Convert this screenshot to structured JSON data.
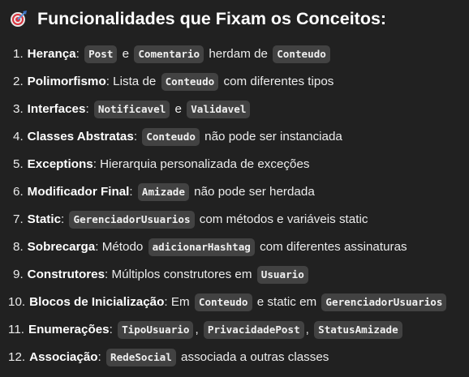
{
  "heading": {
    "icon": "target-icon",
    "title": "Funcionalidades que Fixam os Conceitos:"
  },
  "items": [
    {
      "num": "1.",
      "parts": [
        {
          "t": "b",
          "v": "Herança"
        },
        {
          "t": "p",
          "v": ": "
        },
        {
          "t": "c",
          "v": "Post"
        },
        {
          "t": "p",
          "v": " e "
        },
        {
          "t": "c",
          "v": "Comentario"
        },
        {
          "t": "p",
          "v": " herdam de "
        },
        {
          "t": "c",
          "v": "Conteudo"
        }
      ]
    },
    {
      "num": "2.",
      "parts": [
        {
          "t": "b",
          "v": "Polimorfismo"
        },
        {
          "t": "p",
          "v": ": Lista de "
        },
        {
          "t": "c",
          "v": "Conteudo"
        },
        {
          "t": "p",
          "v": " com diferentes tipos"
        }
      ]
    },
    {
      "num": "3.",
      "parts": [
        {
          "t": "b",
          "v": "Interfaces"
        },
        {
          "t": "p",
          "v": ": "
        },
        {
          "t": "c",
          "v": "Notificavel"
        },
        {
          "t": "p",
          "v": " e "
        },
        {
          "t": "c",
          "v": "Validavel"
        }
      ]
    },
    {
      "num": "4.",
      "parts": [
        {
          "t": "b",
          "v": "Classes Abstratas"
        },
        {
          "t": "p",
          "v": ": "
        },
        {
          "t": "c",
          "v": "Conteudo"
        },
        {
          "t": "p",
          "v": " não pode ser instanciada"
        }
      ]
    },
    {
      "num": "5.",
      "parts": [
        {
          "t": "b",
          "v": "Exceptions"
        },
        {
          "t": "p",
          "v": ": Hierarquia personalizada de exceções"
        }
      ]
    },
    {
      "num": "6.",
      "parts": [
        {
          "t": "b",
          "v": "Modificador Final"
        },
        {
          "t": "p",
          "v": ": "
        },
        {
          "t": "c",
          "v": "Amizade"
        },
        {
          "t": "p",
          "v": " não pode ser herdada"
        }
      ]
    },
    {
      "num": "7.",
      "parts": [
        {
          "t": "b",
          "v": "Static"
        },
        {
          "t": "p",
          "v": ": "
        },
        {
          "t": "c",
          "v": "GerenciadorUsuarios"
        },
        {
          "t": "p",
          "v": " com métodos e variáveis static"
        }
      ]
    },
    {
      "num": "8.",
      "parts": [
        {
          "t": "b",
          "v": "Sobrecarga"
        },
        {
          "t": "p",
          "v": ": Método "
        },
        {
          "t": "c",
          "v": "adicionarHashtag"
        },
        {
          "t": "p",
          "v": " com diferentes assinaturas"
        }
      ]
    },
    {
      "num": "9.",
      "parts": [
        {
          "t": "b",
          "v": "Construtores"
        },
        {
          "t": "p",
          "v": ": Múltiplos construtores em "
        },
        {
          "t": "c",
          "v": "Usuario"
        }
      ]
    },
    {
      "num": "10.",
      "parts": [
        {
          "t": "b",
          "v": "Blocos de Inicialização"
        },
        {
          "t": "p",
          "v": ": Em "
        },
        {
          "t": "c",
          "v": "Conteudo"
        },
        {
          "t": "p",
          "v": " e static em "
        },
        {
          "t": "c",
          "v": "GerenciadorUsuarios"
        }
      ]
    },
    {
      "num": "11.",
      "parts": [
        {
          "t": "b",
          "v": "Enumerações"
        },
        {
          "t": "p",
          "v": ": "
        },
        {
          "t": "c",
          "v": "TipoUsuario"
        },
        {
          "t": "p",
          "v": ", "
        },
        {
          "t": "c",
          "v": "PrivacidadePost"
        },
        {
          "t": "p",
          "v": ", "
        },
        {
          "t": "c",
          "v": "StatusAmizade"
        }
      ]
    },
    {
      "num": "12.",
      "parts": [
        {
          "t": "b",
          "v": "Associação"
        },
        {
          "t": "p",
          "v": ": "
        },
        {
          "t": "c",
          "v": "RedeSocial"
        },
        {
          "t": "p",
          "v": " associada a outras classes"
        }
      ]
    }
  ]
}
